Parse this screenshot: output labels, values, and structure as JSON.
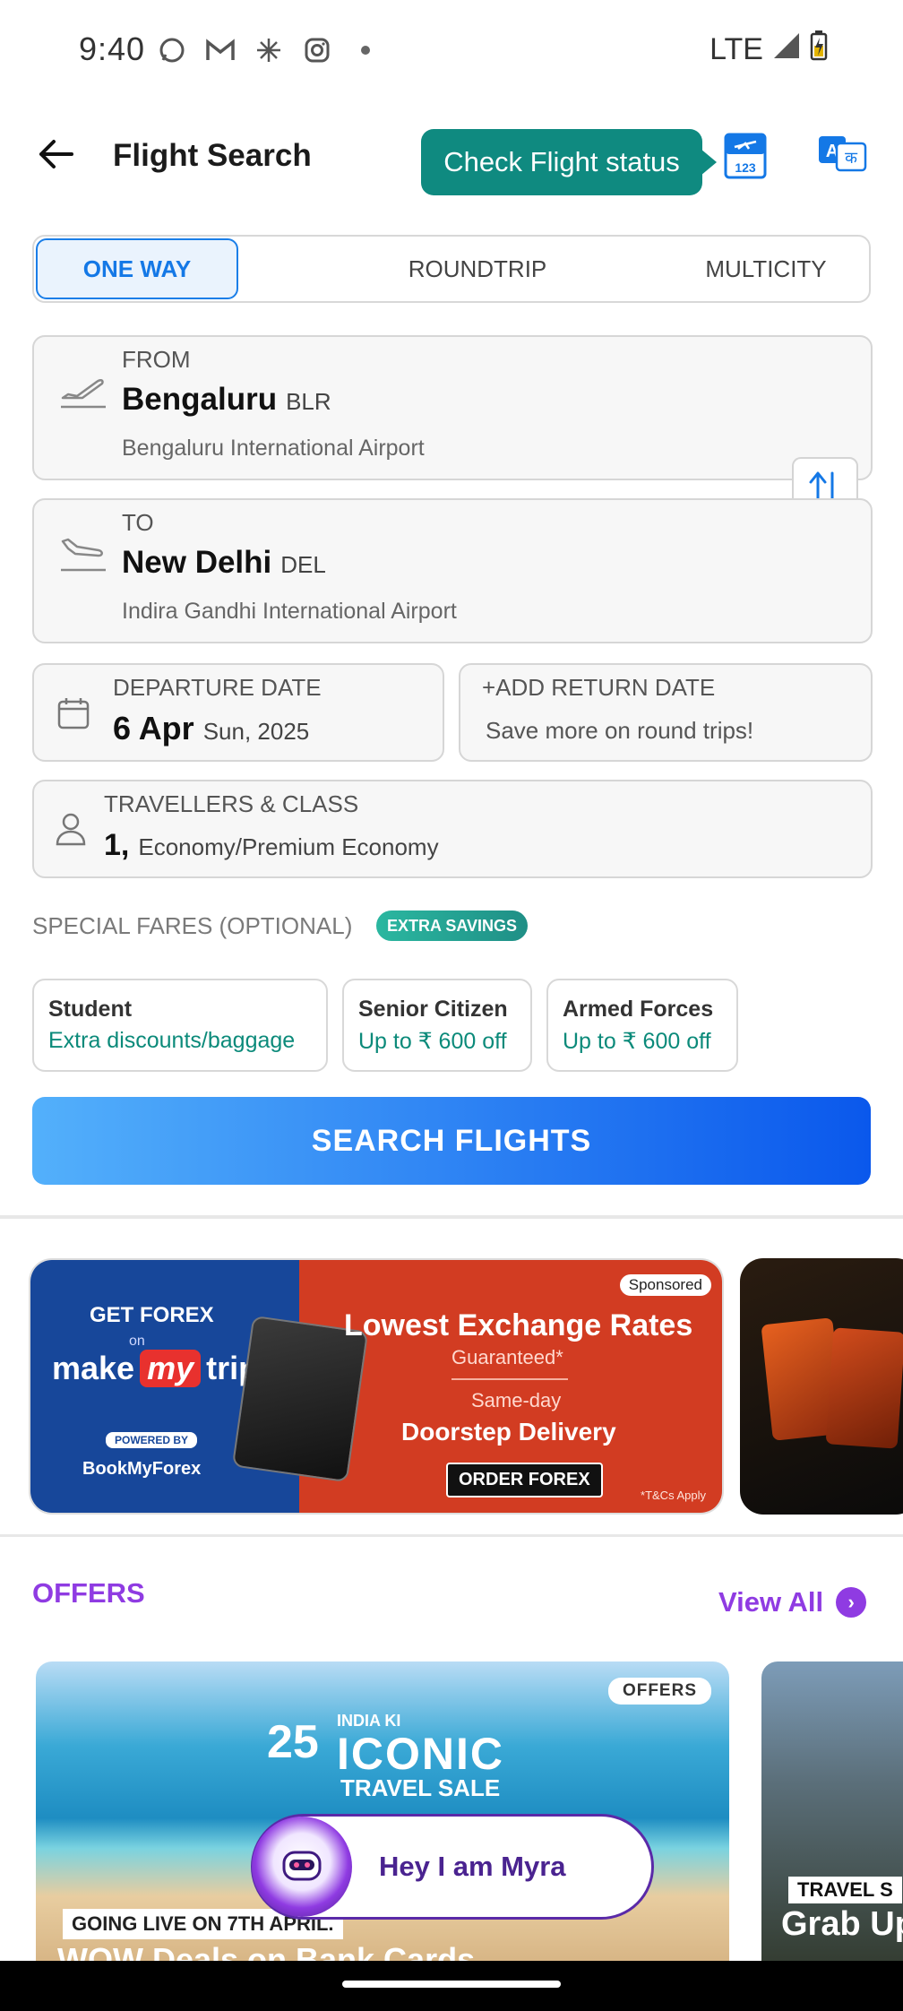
{
  "status_bar": {
    "time": "9:40",
    "network": "LTE",
    "icons": [
      "whatsapp-icon",
      "gmail-icon",
      "sparkle-icon",
      "instagram-icon",
      "dot-icon"
    ]
  },
  "header": {
    "title": "Flight Search",
    "status_button": "Check Flight status"
  },
  "trip_tabs": {
    "one_way": "ONE WAY",
    "roundtrip": "ROUNDTRIP",
    "multicity": "MULTICITY",
    "active": "one_way"
  },
  "from": {
    "label": "FROM",
    "city": "Bengaluru",
    "code": "BLR",
    "airport": "Bengaluru International Airport"
  },
  "to": {
    "label": "TO",
    "city": "New Delhi",
    "code": "DEL",
    "airport": "Indira Gandhi International Airport"
  },
  "departure": {
    "label": "DEPARTURE DATE",
    "date": "6 Apr",
    "day_year": "Sun, 2025"
  },
  "return": {
    "label": "+ADD RETURN DATE",
    "hint": "Save more on round trips!"
  },
  "travellers": {
    "label": "TRAVELLERS & CLASS",
    "count": "1,",
    "class": "Economy/Premium Economy"
  },
  "special_fares": {
    "title": "SPECIAL FARES (OPTIONAL)",
    "badge": "EXTRA SAVINGS",
    "options": [
      {
        "title": "Student",
        "desc": "Extra discounts/baggage"
      },
      {
        "title": "Senior Citizen",
        "desc": "Up to ₹ 600 off"
      },
      {
        "title": "Armed Forces",
        "desc": "Up to ₹ 600 off"
      }
    ]
  },
  "search_button": "SEARCH FLIGHTS",
  "forex_banner": {
    "get_forex": "GET FOREX",
    "on": "on",
    "make": "make",
    "my": "my",
    "trip": "trip",
    "powered_by": "POWERED BY",
    "bmf": "BookMyForex",
    "sponsored": "Sponsored",
    "headline": "Lowest Exchange Rates",
    "guaranteed": "Guaranteed*",
    "same_day": "Same-day",
    "delivery": "Doorstep Delivery",
    "cta": "ORDER FOREX",
    "tc": "*T&Cs Apply"
  },
  "offers": {
    "title": "OFFERS",
    "view_all": "View All",
    "card1": {
      "badge": "OFFERS",
      "years": "25",
      "tagline_top": "INDIA KI",
      "tagline_main": "ICONIC",
      "tagline_sub": "TRAVEL SALE",
      "going_live": "GOING LIVE ON 7TH APRIL.",
      "deals": "WOW Deals on Bank Cards"
    },
    "card2": {
      "tag": "TRAVEL S",
      "headline": "Grab Up"
    }
  },
  "myra": {
    "text": "Hey I am Myra"
  },
  "colors": {
    "teal": "#0f8a80",
    "blue_active": "#1478e6",
    "purple": "#8f3be2",
    "search_gradient_start": "#53b0fb",
    "search_gradient_end": "#0a58ec"
  }
}
